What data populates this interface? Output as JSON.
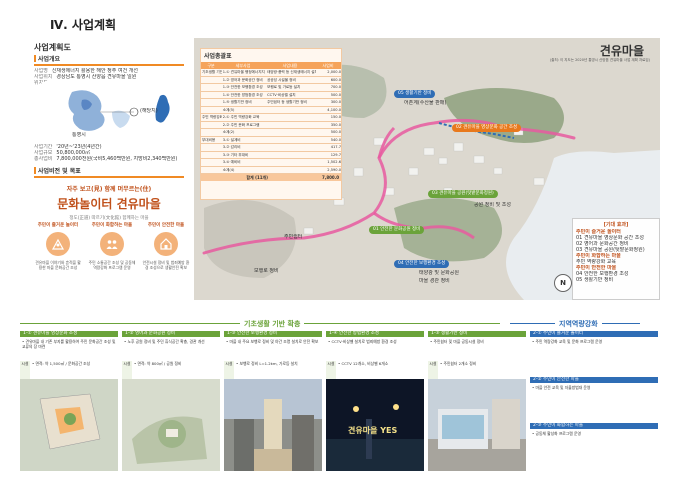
{
  "page": {
    "section_title": "Ⅳ. 사업계획"
  },
  "left": {
    "title": "사업계획도",
    "overview_title": "사업개요",
    "overview_rows": [
      {
        "k": "사업명",
        "v": "신재생에너지 활용한 해안 정주 여건 개선"
      },
      {
        "k": "사업위치",
        "v": "경상남도 통영시 산양읍 견유마을 일원"
      },
      {
        "k": "위치도",
        "v": ""
      }
    ],
    "map_labels": {
      "site": "(해당지)",
      "city": "통영시"
    },
    "facts": [
      {
        "k": "사업기간",
        "v": "'20년~'23년(4년간)"
      },
      {
        "k": "사업규모",
        "v": "50,800,000㎡"
      },
      {
        "k": "총사업비",
        "v": "7,800,000천원(국비5,460백만원, 지방비2,340백만원)"
      }
    ],
    "vision_title": "사업비전 및 목표",
    "slogan_top": "자주 보고(見) 함께 머무르는(住)",
    "slogan_main": "문화놀이터 견유마을",
    "slogan_sub": "정도(正道) 따르기(文化館) 함께하는 마을",
    "goals": [
      {
        "title": "주민이 즐거운 놀이터",
        "desc": "견유마을 이야기와 흔적을 활용한 마을 문화공간 조성"
      },
      {
        "title": "주민이 화합하는 마을",
        "desc": "주민 소통공간 조성 및 공동체 역량강화 프로그램 운영"
      },
      {
        "title": "주민이 안전한 마을",
        "desc": "안전시설 정비 및 범죄예방 환경 조성으로 생활안전 확보"
      }
    ]
  },
  "cost": {
    "title": "사업총괄표",
    "header": [
      "구분",
      "세부사업",
      "사업내용",
      "사업비"
    ],
    "groups": [
      {
        "name": "기초생활 기반확충",
        "rows": [
          {
            "item": "1-① 견유마을 행정에너지지 조성",
            "desc": "태양광·풍력 등 신재생에너지 설치",
            "cost": "2,000.0"
          },
          {
            "item": "1-② 영어과 문화공간 정비",
            "desc": "공공성 시설물 정비",
            "cost": "600.0"
          },
          {
            "item": "1-③ 안전한 보행환경 조성",
            "desc": "보행로 및 가로등 설치",
            "cost": "700.0"
          },
          {
            "item": "1-④ 안전한 방범환경 조성",
            "desc": "CCTV·비상벨 설치",
            "cost": "500.0"
          },
          {
            "item": "1-⑤ 생활기반 정비",
            "desc": "주민쉼터 등 생활기반 정비",
            "cost": "300.0"
          },
          {
            "item": "소계(5)",
            "desc": "",
            "cost": "4,100.0"
          }
        ]
      },
      {
        "name": "주민 역량강화",
        "rows": [
          {
            "item": "2-① 주민 역량강화 교육",
            "desc": "",
            "cost": "150.0"
          },
          {
            "item": "2-② 주민 문화 프로그램",
            "desc": "",
            "cost": "350.0"
          },
          {
            "item": "소계(2)",
            "desc": "",
            "cost": "500.0"
          }
        ]
      },
      {
        "name": "부대비용",
        "rows": [
          {
            "item": "3-① 설계비",
            "desc": "",
            "cost": "540.0"
          },
          {
            "item": "3-② 감리비",
            "desc": "",
            "cost": "417.7"
          },
          {
            "item": "3-③ 기타 부대비",
            "desc": "",
            "cost": "129.7"
          },
          {
            "item": "3-④ 예비비",
            "desc": "",
            "cost": "1,502.6"
          },
          {
            "item": "소계(4)",
            "desc": "",
            "cost": "2,590.0"
          }
        ]
      }
    ],
    "total_label": "합계 (11개)",
    "total_cost": "7,800.0"
  },
  "map": {
    "title": "견유마을",
    "subtitle": "(출처: 이 지도는 2020년 통영시 산양읍 견유마을 사업 계획 자료임)",
    "labels": [
      {
        "num": "05",
        "text": "생활기반 정비",
        "color": "#2f6db5"
      },
      {
        "num": "02",
        "text": "견유마을 영상문화 공간 조성",
        "color": "#e8791d"
      },
      {
        "num": "03",
        "text": "견유마을 공원(텃밭문화정원)",
        "color": "#6ba33a"
      },
      {
        "num": "01",
        "text": "안전한 문화공원 정비",
        "color": "#6ba33a"
      },
      {
        "num": "04",
        "text": "안전한 보행환경 조성",
        "color": "#2f6db5"
      }
    ],
    "small_texts": [
      "어촌계(수산물 판매)",
      "태양광 및 문화공원",
      "마을 경관 정비",
      "주민쉼터",
      "공원 정비 및 조성",
      "보행로 정비"
    ],
    "legend_title": "[기대 효과]",
    "legend_items": [
      "주민이 즐거운 놀이터",
      "01 견유마을 영상문화 공간 조성",
      "02 영어과 문화공간 정비",
      "03 견유마을 공원(텃밭문화정원)",
      "주민이 화합하는 마을",
      "주민 역량강화 교육",
      "주민이 안전한 마을",
      "04 안전한 보행환경 조성",
      "05 생활기반 정비"
    ],
    "north": "N"
  },
  "bottom": {
    "band_left": "기초생활 기반 확충",
    "band_right": "지역역량강화",
    "cols": [
      {
        "head": "1-① 견유마을 영상문화 조성",
        "desc": "• 견유마을 내 기존 부지를 활용하여 주민 문화공간 조성 및 교류의 장 마련",
        "spec": "• 면적: 약 1,500㎡ / 문화공간 조성",
        "tag": "시설"
      },
      {
        "head": "1-② 영어과 문화공원 정비",
        "desc": "• 노후 공원 정비 및 주민 휴식공간 확충, 경관 개선",
        "spec": "• 면적: 약 800㎡ / 공원 정비",
        "tag": "시설"
      },
      {
        "head": "1-③ 안전한 보행환경 정비",
        "desc": "• 마을 내 주요 보행로 정비 및 야간 조명 설치로 안전 확보",
        "spec": "• 보행로 정비 L=1.2km, 가로등 설치",
        "tag": "시설"
      },
      {
        "head": "1-④ 안전한 방범환경 조성",
        "desc": "• CCTV·비상벨 설치로 범죄예방 환경 조성",
        "spec": "• CCTV 12개소, 비상벨 6개소",
        "tag": "시설"
      },
      {
        "head": "1-⑤ 생활기반 정비",
        "desc": "• 주민쉼터 및 마을 공동시설 정비",
        "spec": "• 주민쉼터 2개소 정비",
        "tag": "시설"
      }
    ],
    "photo_caption": "견유마을 YES",
    "right_heads": [
      "2-① 주민이 즐거운 놀이터",
      "2-② 주민이 안전한 마을",
      "2-③ 주민이 화합하는 마을"
    ],
    "right_desc": [
      "• 주민 역량강화 교육 및 문화 프로그램 운영",
      "• 마을 안전 교육 및 자율방범대 운영",
      "• 공동체 활성화 프로그램 운영"
    ]
  }
}
